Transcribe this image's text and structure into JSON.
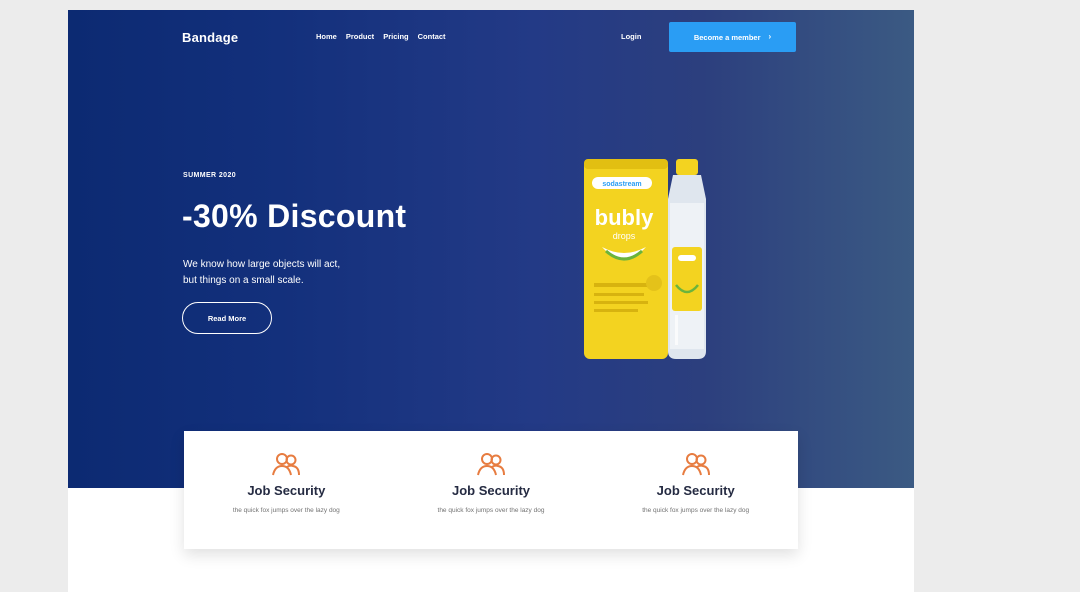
{
  "nav": {
    "brand": "Bandage",
    "links": [
      "Home",
      "Product",
      "Pricing",
      "Contact"
    ],
    "login": "Login",
    "cta": "Become a member"
  },
  "hero": {
    "season": "SUMMER 2020",
    "headline": "-30% Discount",
    "description_line1": "We know how large objects will act,",
    "description_line2": "but things on a small scale.",
    "button": "Read More"
  },
  "product": {
    "bag_brand": "sodastream",
    "bag_name": "bubly",
    "bag_sub": "drops"
  },
  "features": [
    {
      "icon": "users-icon",
      "title": "Job Security",
      "text": "the quick fox jumps over the lazy dog"
    },
    {
      "icon": "users-icon",
      "title": "Job Security",
      "text": "the quick fox jumps over the lazy dog"
    },
    {
      "icon": "users-icon",
      "title": "Job Security",
      "text": "the quick fox jumps over the lazy dog"
    }
  ],
  "colors": {
    "hero_start": "#0c2a72",
    "hero_end": "#3b5a83",
    "cta": "#2a9df4",
    "feature_icon": "#e77c40",
    "feature_title": "#252b42",
    "feature_text": "#737373"
  }
}
